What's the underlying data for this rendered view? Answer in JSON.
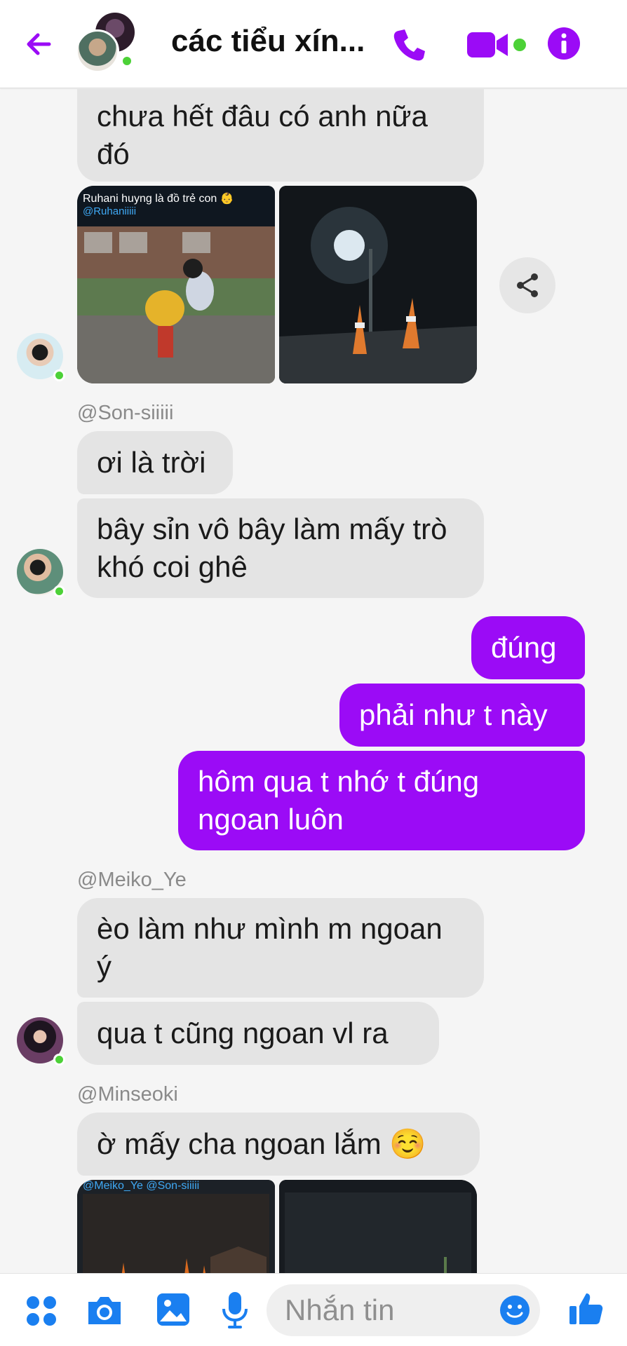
{
  "header": {
    "title": "các tiểu xín...",
    "accent": "#9b0bf6",
    "online_color": "#4cd137",
    "icons": [
      "back-arrow-icon",
      "phone-icon",
      "video-camera-icon",
      "info-icon"
    ]
  },
  "photos_1": {
    "left_caption": "Ruhani huyng là đồ trẻ con 👶",
    "left_handle": "@Ruhaniiiii"
  },
  "photos_2": {
    "left_caption": "@Meiko_Ye @Son-siiiii"
  },
  "messages": {
    "m1": "chưa hết đâu có anh nữa đó",
    "sender_son": "@Son-siiiii",
    "m2": "ơi là trời",
    "m3": "bây sỉn vô bây làm mấy trò khó coi ghê",
    "m4": "đúng",
    "m5": "phải như t này",
    "m6": "hôm qua t nhớ t đúng ngoan luôn",
    "sender_meiko": "@Meiko_Ye",
    "m7": "èo làm như mình m ngoan ý",
    "m8": "qua t cũng ngoan vl ra",
    "sender_minseoki": "@Minseoki",
    "m9": "ờ mấy cha ngoan lắm ☺️"
  },
  "composer": {
    "placeholder": "Nhắn tin",
    "icons": [
      "apps-icon",
      "camera-icon",
      "gallery-icon",
      "microphone-icon",
      "emoji-icon",
      "thumbs-up-icon"
    ]
  }
}
